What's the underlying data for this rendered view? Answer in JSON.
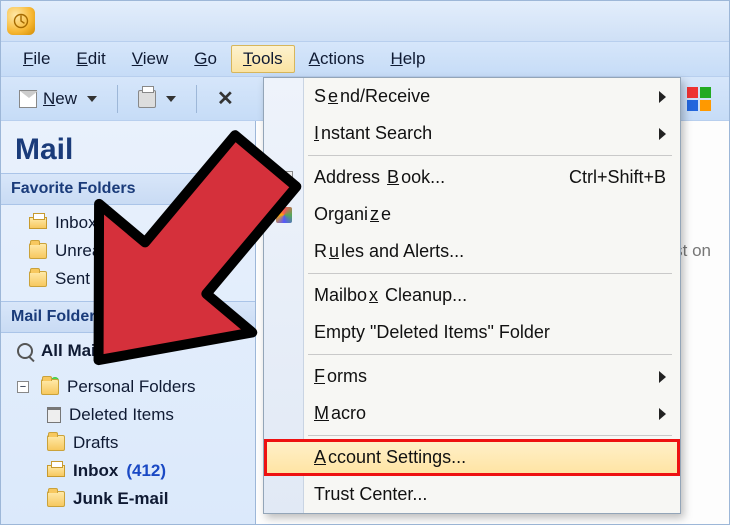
{
  "menubar": {
    "file": "File",
    "file_m": "F",
    "edit": "Edit",
    "edit_m": "E",
    "view": "View",
    "view_m": "V",
    "go": "Go",
    "go_m": "G",
    "tools": "Tools",
    "tools_m": "T",
    "actions": "Actions",
    "actions_m": "A",
    "help": "Help",
    "help_m": "H"
  },
  "toolbar": {
    "new_label": "New",
    "new_m": "N"
  },
  "nav": {
    "title": "Mail",
    "fav_header": "Favorite Folders",
    "fav": {
      "inbox": "Inbox",
      "unread": "Unread Mail",
      "sent": "Sent Items"
    },
    "folders_header": "Mail Folders",
    "all": "All Mail Items",
    "pf": "Personal Folders",
    "deleted": "Deleted Items",
    "drafts": "Drafts",
    "inbox": "Inbox",
    "inbox_count": "(412)",
    "junk": "Junk E-mail"
  },
  "main": {
    "hint": "vest on"
  },
  "menu": {
    "send_receive": "Send/Receive",
    "send_receive_m": "e",
    "instant_search": "Instant Search",
    "instant_search_m": "I",
    "address_book": "Address Book...",
    "address_book_m": "B",
    "address_book_accel": "Ctrl+Shift+B",
    "organize": "Organize",
    "organize_m": "z",
    "rules": "Rules and Alerts...",
    "rules_m": "u",
    "mailbox_cleanup": "Mailbox Cleanup...",
    "mailbox_cleanup_m": "x",
    "empty_deleted": "Empty \"Deleted Items\" Folder",
    "forms": "Forms",
    "forms_m": "F",
    "macro": "Macro",
    "macro_m": "M",
    "account_settings": "Account Settings...",
    "account_settings_m": "A",
    "trust_center": "Trust Center..."
  }
}
